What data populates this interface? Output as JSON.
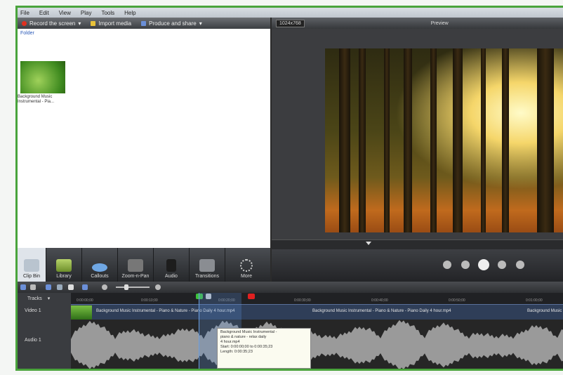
{
  "menu": [
    "File",
    "Edit",
    "View",
    "Play",
    "Tools",
    "Help"
  ],
  "toolbar": {
    "record": "Record the screen",
    "import": "Import media",
    "produce": "Produce and share"
  },
  "clip_bin": {
    "link": "Folder",
    "item_caption": "Background Music Instrumental - Pia..."
  },
  "tabs": [
    {
      "label": "Clip Bin"
    },
    {
      "label": "Library"
    },
    {
      "label": "Callouts"
    },
    {
      "label": "Zoom-n-Pan"
    },
    {
      "label": "Audio"
    },
    {
      "label": "Transitions"
    },
    {
      "label": "More"
    }
  ],
  "preview": {
    "resolution": "1024x768",
    "mode": "Preview"
  },
  "timeline": {
    "tracks_label": "Tracks",
    "video_track": "Video 1",
    "audio_track": "Audio 1",
    "ticks": [
      "0:00:00;00",
      "0:00:10;00",
      "0:00:20;00",
      "0:00:30;00",
      "0:00:40;00",
      "0:00:50;00",
      "0:01:00;00"
    ],
    "clip_label": "Background Music Instrumental - Piano & Nature - Piano Daily 4 hour.mp4",
    "tooltip": [
      "Background Music Instrumental -",
      "piano & nature - relax daily",
      "4 hour.mp4",
      "Start: 0:00:00;00 to 0:00:35;23",
      "Length: 0:00:35;23"
    ]
  },
  "colors": {
    "frame_border": "#4aa43c",
    "accent_record": "#e03020",
    "marker_green": "#3cc23c",
    "marker_red": "#e02020"
  }
}
